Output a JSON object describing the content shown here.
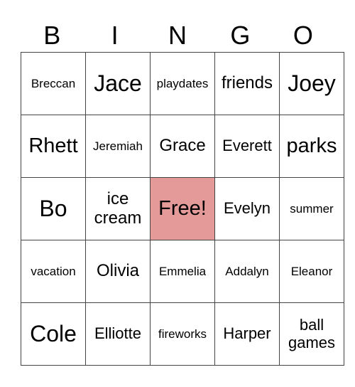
{
  "header": [
    "B",
    "I",
    "N",
    "G",
    "O"
  ],
  "free_color": "#E59A9A",
  "cells": [
    [
      "Breccan",
      "Jace",
      "playdates",
      "friends",
      "Joey"
    ],
    [
      "Rhett",
      "Jeremiah",
      "Grace",
      "Everett",
      "parks"
    ],
    [
      "Bo",
      "ice cream",
      "Free!",
      "Evelyn",
      "summer"
    ],
    [
      "vacation",
      "Olivia",
      "Emmelia",
      "Addalyn",
      "Eleanor"
    ],
    [
      "Cole",
      "Elliotte",
      "fireworks",
      "Harper",
      "ball games"
    ]
  ]
}
